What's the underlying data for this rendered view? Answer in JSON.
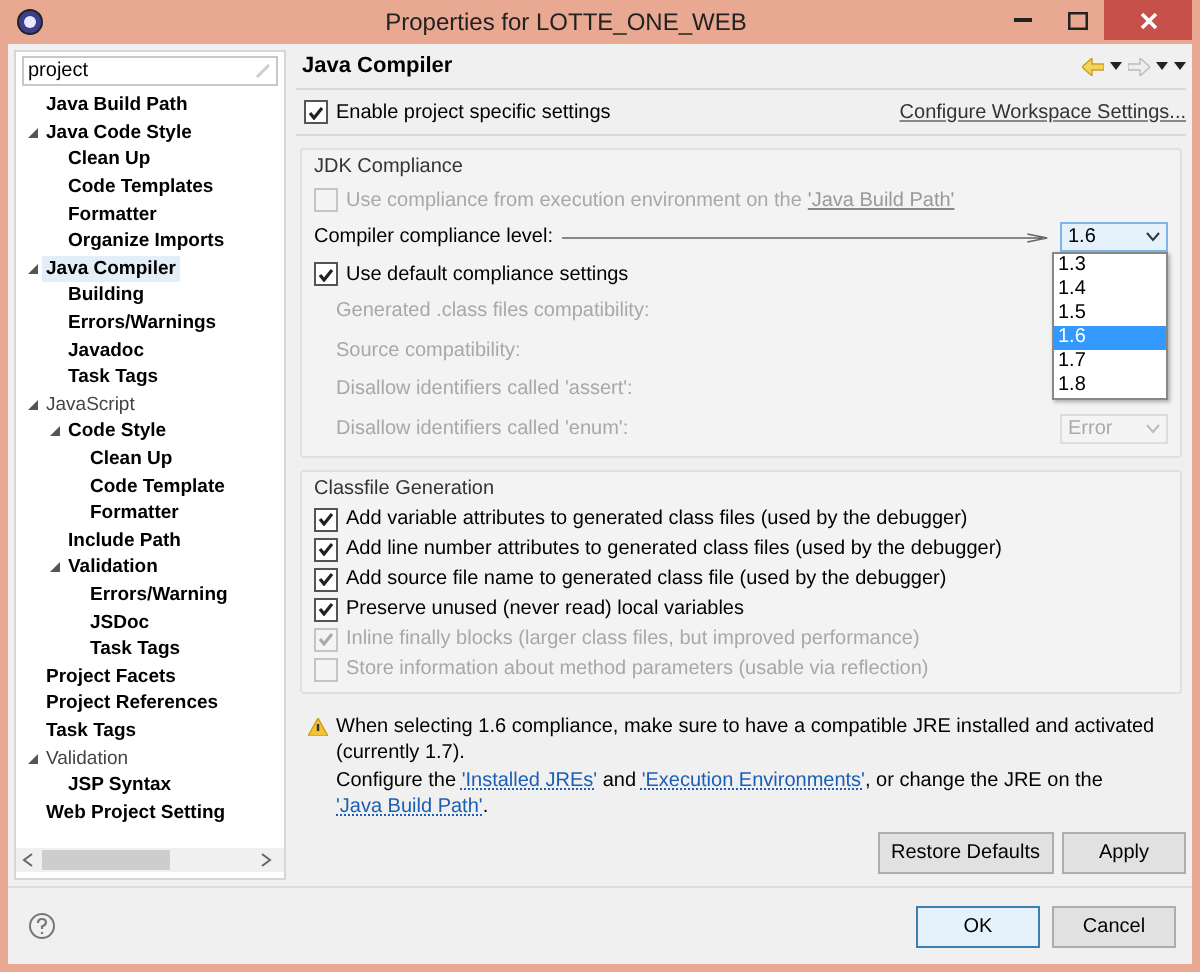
{
  "window": {
    "title": "Properties for LOTTE_ONE_WEB"
  },
  "filter": {
    "value": "project"
  },
  "tree": [
    {
      "label": "Java Build Path",
      "matched": true,
      "expanded": false,
      "selected": false
    },
    {
      "label": "Java Code Style",
      "matched": true,
      "expanded": true,
      "selected": false,
      "children": [
        {
          "label": "Clean Up",
          "matched": true,
          "expanded": false,
          "selected": false
        },
        {
          "label": "Code Templates",
          "matched": true,
          "expanded": false,
          "selected": false
        },
        {
          "label": "Formatter",
          "matched": true,
          "expanded": false,
          "selected": false
        },
        {
          "label": "Organize Imports",
          "matched": true,
          "expanded": false,
          "selected": false
        }
      ]
    },
    {
      "label": "Java Compiler",
      "matched": true,
      "expanded": true,
      "selected": true,
      "children": [
        {
          "label": "Building",
          "matched": true,
          "expanded": false,
          "selected": false
        },
        {
          "label": "Errors/Warnings",
          "matched": true,
          "expanded": false,
          "selected": false
        },
        {
          "label": "Javadoc",
          "matched": true,
          "expanded": false,
          "selected": false
        },
        {
          "label": "Task Tags",
          "matched": true,
          "expanded": false,
          "selected": false
        }
      ]
    },
    {
      "label": "JavaScript",
      "matched": false,
      "expanded": true,
      "selected": false,
      "children": [
        {
          "label": "Code Style",
          "matched": true,
          "expanded": true,
          "selected": false,
          "children": [
            {
              "label": "Clean Up",
              "matched": true,
              "expanded": false,
              "selected": false
            },
            {
              "label": "Code Template",
              "matched": true,
              "expanded": false,
              "selected": false
            },
            {
              "label": "Formatter",
              "matched": true,
              "expanded": false,
              "selected": false
            }
          ]
        },
        {
          "label": "Include Path",
          "matched": true,
          "expanded": false,
          "selected": false
        },
        {
          "label": "Validation",
          "matched": true,
          "expanded": true,
          "selected": false,
          "children": [
            {
              "label": "Errors/Warning",
              "matched": true,
              "expanded": false,
              "selected": false
            },
            {
              "label": "JSDoc",
              "matched": true,
              "expanded": false,
              "selected": false
            },
            {
              "label": "Task Tags",
              "matched": true,
              "expanded": false,
              "selected": false
            }
          ]
        }
      ]
    },
    {
      "label": "Project Facets",
      "matched": true,
      "expanded": false,
      "selected": false
    },
    {
      "label": "Project References",
      "matched": true,
      "expanded": false,
      "selected": false
    },
    {
      "label": "Task Tags",
      "matched": true,
      "expanded": false,
      "selected": false
    },
    {
      "label": "Validation",
      "matched": false,
      "expanded": true,
      "selected": false,
      "children": [
        {
          "label": "JSP Syntax",
          "matched": true,
          "expanded": false,
          "selected": false
        }
      ]
    },
    {
      "label": "Web Project Setting",
      "matched": true,
      "expanded": false,
      "selected": false
    }
  ],
  "page": {
    "title": "Java Compiler",
    "enable": {
      "label": "Enable project specific settings",
      "checked": true,
      "disabled": false
    },
    "workspace_link": "Configure Workspace Settings...",
    "jdk_group": {
      "title": "JDK Compliance",
      "use_ee": {
        "label": "Use compliance from execution environment on the",
        "link": "'Java Build Path'",
        "checked": false,
        "disabled": true
      },
      "compliance": {
        "label": "Compiler compliance level:",
        "value": "1.6",
        "expanded": true,
        "options": [
          {
            "label": "1.3",
            "selected": false
          },
          {
            "label": "1.4",
            "selected": false
          },
          {
            "label": "1.5",
            "selected": false
          },
          {
            "label": "1.6",
            "selected": true
          },
          {
            "label": "1.7",
            "selected": false
          },
          {
            "label": "1.8",
            "selected": false
          }
        ]
      },
      "use_default": {
        "label": "Use default compliance settings",
        "checked": true,
        "disabled": false
      },
      "settings": [
        {
          "label": "Generated .class files compatibility:",
          "disabled": true
        },
        {
          "label": "Source compatibility:",
          "disabled": true
        },
        {
          "label": "Disallow identifiers called 'assert':",
          "disabled": true
        },
        {
          "label": "Disallow identifiers called 'enum':",
          "disabled": true,
          "value": "Error"
        }
      ]
    },
    "classfile_group": {
      "title": "Classfile Generation",
      "options": [
        {
          "label": "Add variable attributes to generated class files (used by the debugger)",
          "checked": true,
          "disabled": false
        },
        {
          "label": "Add line number attributes to generated class files (used by the debugger)",
          "checked": true,
          "disabled": false
        },
        {
          "label": "Add source file name to generated class file (used by the debugger)",
          "checked": true,
          "disabled": false
        },
        {
          "label": "Preserve unused (never read) local variables",
          "checked": true,
          "disabled": false
        },
        {
          "label": "Inline finally blocks (larger class files, but improved performance)",
          "checked": true,
          "disabled": true
        },
        {
          "label": "Store information about method parameters (usable via reflection)",
          "checked": false,
          "disabled": true
        }
      ]
    },
    "warning": {
      "lines": [
        [
          {
            "kind": "text",
            "text": "When selecting 1.6 compliance, make sure to have a compatible JRE installed and activated (currently 1.7)."
          }
        ],
        [
          {
            "kind": "text",
            "text": "Configure the "
          },
          {
            "kind": "link",
            "text": "'Installed JREs'"
          },
          {
            "kind": "text",
            "text": " and "
          },
          {
            "kind": "link",
            "text": "'Execution Environments'"
          },
          {
            "kind": "text",
            "text": ", or change the JRE on the "
          },
          {
            "kind": "link",
            "text": "'Java Build Path'"
          },
          {
            "kind": "text",
            "text": "."
          }
        ]
      ]
    },
    "buttons": [
      "Restore Defaults",
      "Apply"
    ]
  },
  "footer": {
    "buttons": [
      {
        "label": "OK",
        "default": true
      },
      {
        "label": "Cancel",
        "default": false
      }
    ]
  }
}
